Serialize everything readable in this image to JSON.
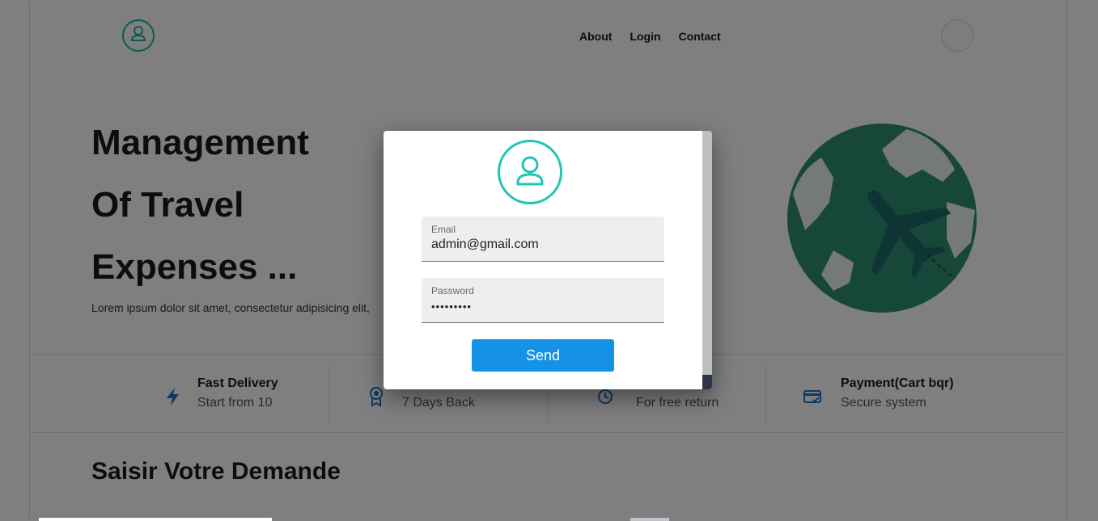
{
  "nav": {
    "items": [
      "About",
      "Login",
      "Contact"
    ]
  },
  "hero": {
    "title_lines": [
      "Management",
      "Of Travel",
      "Expenses ..."
    ],
    "text": "Lorem ipsum dolor sit amet, consectetur adipisicing elit,"
  },
  "features": [
    {
      "title": "Fast Delivery",
      "subtitle": "Start from 10",
      "icon": "lightning-icon"
    },
    {
      "title": "",
      "subtitle": "7 Days Back",
      "icon": "award-icon"
    },
    {
      "title": "",
      "subtitle": "For free return",
      "icon": "clock-icon"
    },
    {
      "title": "Payment(Cart bqr)",
      "subtitle": "Secure system",
      "icon": "credit-card-icon"
    }
  ],
  "section": {
    "title": "Saisir Votre Demande"
  },
  "modal": {
    "email_label": "Email",
    "email_value": "admin@gmail.com",
    "password_label": "Password",
    "password_value": "•••••••••",
    "send_label": "Send"
  },
  "colors": {
    "accent_teal": "#1ec6b3",
    "button_blue": "#1591e6",
    "globe_green": "#2f8f72",
    "plane": "#1d6b66",
    "feature_icon_blue": "#1a73c9"
  }
}
